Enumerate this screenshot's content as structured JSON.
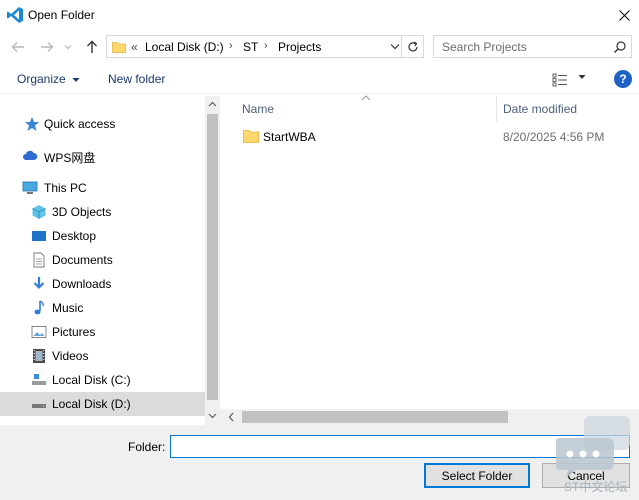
{
  "window": {
    "title": "Open Folder",
    "app_icon": "vscode-icon",
    "accent": "#0078d7"
  },
  "nav": {
    "back_icon": "arrow-left-icon",
    "forward_icon": "arrow-right-icon",
    "recent_icon": "chevron-down-icon",
    "up_icon": "arrow-up-icon"
  },
  "address": {
    "overflow": "«",
    "crumbs": [
      "Local Disk (D:)",
      "ST",
      "Projects"
    ]
  },
  "search": {
    "placeholder": "Search Projects"
  },
  "toolbar": {
    "organize_label": "Organize",
    "new_folder_label": "New folder"
  },
  "sidebar": {
    "items": [
      {
        "label": "Quick access",
        "icon": "star-icon"
      },
      {
        "label": "WPS网盘",
        "icon": "cloud-icon"
      },
      {
        "label": "This PC",
        "icon": "computer-icon"
      },
      {
        "label": "3D Objects",
        "icon": "cube-icon"
      },
      {
        "label": "Desktop",
        "icon": "desktop-icon"
      },
      {
        "label": "Documents",
        "icon": "document-icon"
      },
      {
        "label": "Downloads",
        "icon": "download-icon"
      },
      {
        "label": "Music",
        "icon": "music-icon"
      },
      {
        "label": "Pictures",
        "icon": "picture-icon"
      },
      {
        "label": "Videos",
        "icon": "video-icon"
      },
      {
        "label": "Local Disk (C:)",
        "icon": "drive-c-icon"
      },
      {
        "label": "Local Disk (D:)",
        "icon": "drive-d-icon",
        "selected": true
      }
    ]
  },
  "list": {
    "columns": {
      "name": "Name",
      "date": "Date modified"
    },
    "rows": [
      {
        "name": "StartWBA",
        "date": "8/20/2025 4:56 PM",
        "icon": "folder-icon"
      }
    ]
  },
  "footer": {
    "folder_label": "Folder:",
    "folder_value": "",
    "select_label": "Select Folder",
    "cancel_label": "Cancel"
  },
  "watermark": {
    "text": "ST中文论坛"
  }
}
